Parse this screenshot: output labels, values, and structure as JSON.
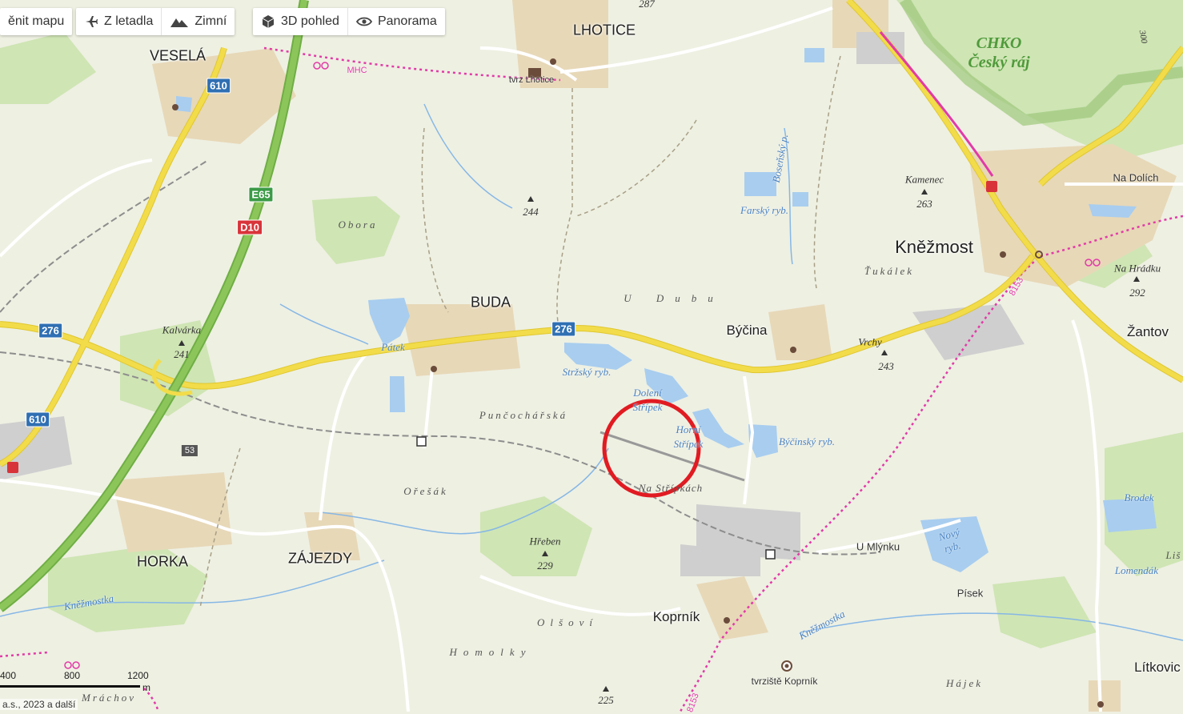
{
  "toolbar": {
    "change_map": "ěnit mapu",
    "aerial": "Z letadla",
    "winter": "Zimní",
    "view3d": "3D pohled",
    "panorama": "Panorama"
  },
  "places": {
    "vesela": "VESELÁ",
    "lhotice": "LHOTICE",
    "buda": "BUDA",
    "horka": "HORKA",
    "zajezdy": "ZÁJEZDY",
    "knezmost": "Kněžmost",
    "bycina": "Býčina",
    "zantov": "Žantov",
    "koprnik": "Koprník",
    "litkovice": "Lítkovic",
    "na_dolich": "Na Dolích",
    "u_mlynku": "U Mlýnku",
    "pisek": "Písek"
  },
  "water": {
    "patek": "Pátek",
    "strzsky": "Stržský ryb.",
    "doleni_line1": "Dolení",
    "doleni_line2": "Střípek",
    "horni_line1": "Horní",
    "horni_line2": "Střípek",
    "bycinsky": "Býčinský ryb.",
    "farsky": "Farský ryb.",
    "bosensky": "Boseňský p.",
    "novy_line1": "Nový",
    "novy_line2": "ryb.",
    "brodek": "Brodek",
    "lomendak": "Lomendák",
    "knezmostka1": "Kněžmostka",
    "knezmostka2": "Kněžmostka"
  },
  "areas": {
    "obora": "Obora",
    "u_dubu": "U Dubu",
    "puncocharska": "Punčochářská",
    "oresak": "Ořešák",
    "olsovi": "Olšoví",
    "homolky": "Homolky",
    "tukalek": "Ťukálek",
    "hajek": "Hájek",
    "mrachov": "Mráchov",
    "na_striprinach": "Na Střípkách",
    "lis": "Liš"
  },
  "peaks": {
    "p287": "287",
    "p244": "244",
    "kalvarka": "Kalvárka",
    "kalvarka_elev": "241",
    "kamenec": "Kamenec",
    "kamenec_elev": "263",
    "vrchy": "Vrchy",
    "vrchy_elev": "243",
    "hreben": "Hřeben",
    "hreben_elev": "229",
    "na_hradku": "Na Hrádku",
    "na_hradku_elev": "292",
    "p225": "225",
    "p300": "300"
  },
  "poi": {
    "tvrz_lhotice": "tvrz Lhotice",
    "tvrziste_koprnik": "tvrziště Koprník",
    "mhc": "MHC",
    "crossing_53": "53"
  },
  "chko": {
    "line1": "CHKO",
    "line2": "Český ráj"
  },
  "roads": {
    "r610a": "610",
    "r610b": "610",
    "r276a": "276",
    "r276b": "276",
    "e65": "E65",
    "d10": "D10",
    "r8153a": "8153",
    "r8153b": "8153"
  },
  "scale": {
    "n400": "400",
    "n800": "800",
    "n1200": "1200",
    "unit": "m"
  },
  "copyright": "a.s., 2023 a další",
  "colors": {
    "background": "#eef0e2",
    "forest": "#cfe5b4",
    "water": "#a8cdef",
    "motorway": "#8cc65a",
    "main_road": "#f2dc4a",
    "settlement": "#e7d8b8",
    "marker": "#e11b22",
    "cycle_route": "#e23aa8"
  }
}
